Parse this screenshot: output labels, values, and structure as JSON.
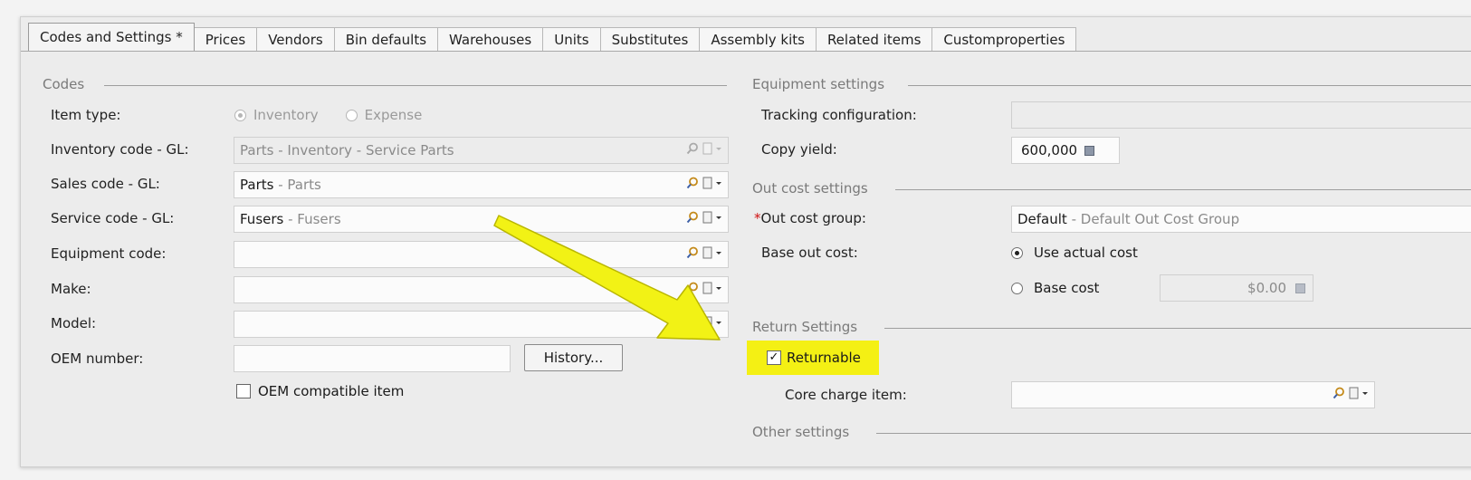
{
  "tabs": [
    {
      "label": "Codes and Settings *",
      "active": true
    },
    {
      "label": "Prices"
    },
    {
      "label": "Vendors"
    },
    {
      "label": "Bin defaults"
    },
    {
      "label": "Warehouses"
    },
    {
      "label": "Units"
    },
    {
      "label": "Substitutes"
    },
    {
      "label": "Assembly kits"
    },
    {
      "label": "Related items"
    },
    {
      "label": "Customproperties"
    }
  ],
  "codes": {
    "title": "Codes",
    "item_type_label": "Item type:",
    "item_type_options": [
      "Inventory",
      "Expense"
    ],
    "item_type_selected": "Inventory",
    "inventory_code_label": "Inventory code - GL:",
    "inventory_code": {
      "code": "Parts",
      "sep": " - ",
      "desc": "Inventory - Service Parts"
    },
    "sales_code_label": "Sales code - GL:",
    "sales_code": {
      "code": "Parts",
      "sep": " - ",
      "desc": "Parts"
    },
    "service_code_label": "Service code - GL:",
    "service_code": {
      "code": "Fusers",
      "sep": " - ",
      "desc": "Fusers"
    },
    "equipment_code_label": "Equipment code:",
    "make_label": "Make:",
    "model_label": "Model:",
    "oem_number_label": "OEM number:",
    "history_button": "History...",
    "oem_compatible_label": "OEM compatible item"
  },
  "equipment": {
    "title": "Equipment settings",
    "tracking_label": "Tracking configuration:",
    "copy_yield_label": "Copy yield:",
    "copy_yield_value": "600,000"
  },
  "out_cost": {
    "title": "Out cost settings",
    "group_required_mark": "*",
    "group_label": "Out cost group:",
    "group_value": {
      "code": "Default",
      "sep": " - ",
      "desc": "Default Out Cost Group"
    },
    "base_label": "Base out cost:",
    "option_actual": "Use actual cost",
    "option_base": "Base cost",
    "selected": "Use actual cost",
    "base_cost_value": "$0.00"
  },
  "return": {
    "title": "Return Settings",
    "returnable_label": "Returnable",
    "returnable_checked": true,
    "core_charge_label": "Core charge item:"
  },
  "other": {
    "title": "Other settings"
  },
  "colors": {
    "highlight": "#f4f014",
    "arrow": "#f2f215"
  },
  "icons": {
    "lookup": "search-icon",
    "memo": "document-dropdown-icon",
    "calculator": "calculator-icon",
    "checkmark": "✓"
  }
}
